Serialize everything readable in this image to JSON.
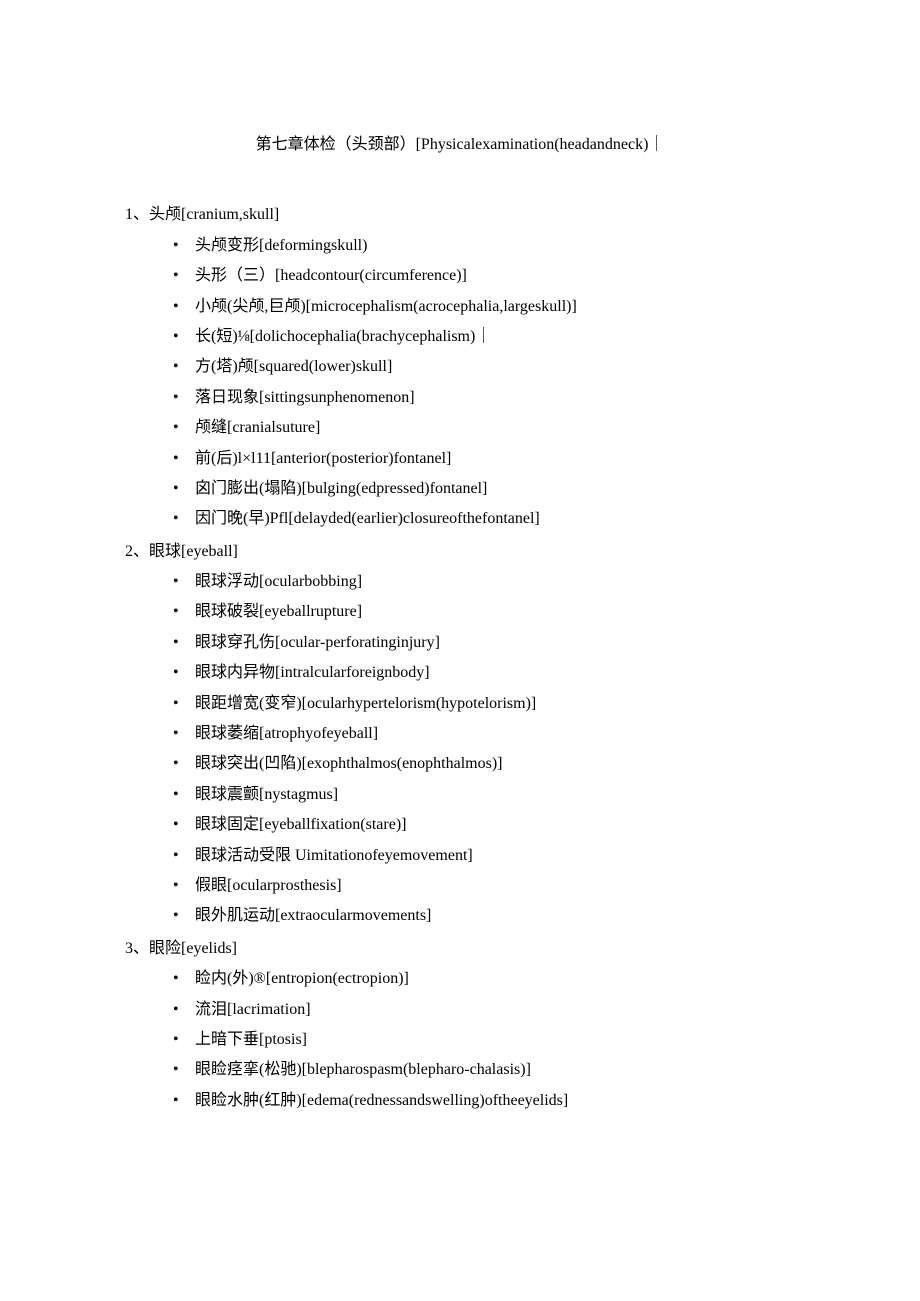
{
  "title": "第七章体检（头颈部）[Physicalexamination(headandneck)｜",
  "sections": [
    {
      "number": "1、",
      "heading": "头颅[cranium,skull]",
      "items": [
        "头颅变形[deformingskull)",
        "头形（三）[headcontour(circumference)]",
        "小颅(尖颅,巨颅)[microcephalism(acrocephalia,largeskull)]",
        "长(短)⅛[dolichocephalia(brachycephalism)｜",
        "方(塔)颅[squared(lower)skull]",
        "落日现象[sittingsunphenomenon]",
        "颅缝[cranialsuture]",
        "前(后)l×l11[anterior(posterior)fontanel]",
        "囟门膨出(塌陷)[bulging(edpressed)fontanel]",
        "因门晚(早)Pfl[delayded(earlier)closureofthefontanel]"
      ]
    },
    {
      "number": "2、",
      "heading": "眼球[eyeball]",
      "items": [
        "眼球浮动[ocularbobbing]",
        "眼球破裂[eyeballrupture]",
        "眼球穿孔伤[ocular-perforatinginjury]",
        "眼球内异物[intralcularforeignbody]",
        "眼距增宽(变窄)[ocularhypertelorism(hypotelorism)]",
        "眼球萎缩[atrophyofeyeball]",
        "眼球突出(凹陷)[exophthalmos(enophthalmos)]",
        "眼球震颤[nystagmus]",
        "眼球固定[eyeballfixation(stare)]",
        "眼球活动受限 Uimitationofeyemovement]",
        "假眼[ocularprosthesis]",
        "眼外肌运动[extraocularmovements]"
      ]
    },
    {
      "number": "3、",
      "heading": "眼险[eyelids]",
      "items": [
        "睑内(外)®[entropion(ectropion)]",
        "流泪[lacrimation]",
        "上暗下垂[ptosis]",
        "眼睑痉挛(松驰)[blepharospasm(blepharo-chalasis)]",
        "眼睑水肿(红肿)[edema(rednessandswelling)oftheeyelids]"
      ]
    }
  ]
}
